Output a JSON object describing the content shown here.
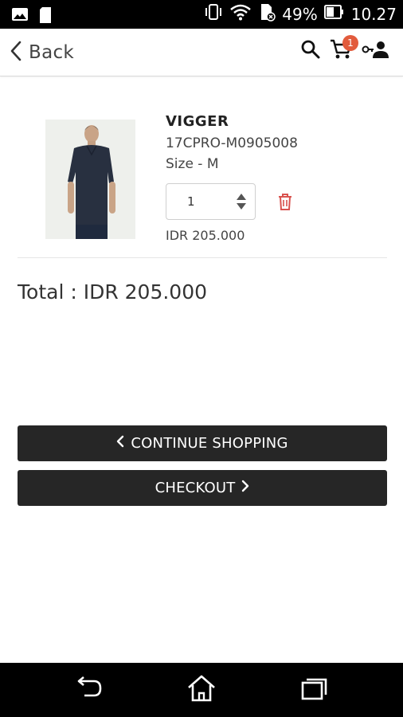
{
  "status_bar": {
    "battery_percent": "49%",
    "time": "10.27",
    "icons": [
      "image-notification-icon",
      "sd-card-icon",
      "vibrate-icon",
      "wifi-icon",
      "sim-no-signal-icon",
      "battery-icon"
    ]
  },
  "header": {
    "back_label": "Back",
    "cart_count": "1",
    "icons": [
      "chevron-left-icon",
      "search-icon",
      "cart-icon",
      "account-icon"
    ]
  },
  "cart_item": {
    "brand": "VIGGER",
    "sku": "17CPRO-M0905008",
    "size": "Size - M",
    "quantity": "1",
    "price": "IDR 205.000"
  },
  "total": "Total : IDR 205.000",
  "buttons": {
    "continue_label": "CONTINUE SHOPPING",
    "checkout_label": "CHECKOUT"
  },
  "nav_bar": {
    "icons": [
      "back-nav-icon",
      "home-nav-icon",
      "recent-apps-icon"
    ]
  },
  "colors": {
    "accent_dark": "#262626",
    "badge": "#e25b3c",
    "delete_icon": "#d9534f"
  }
}
